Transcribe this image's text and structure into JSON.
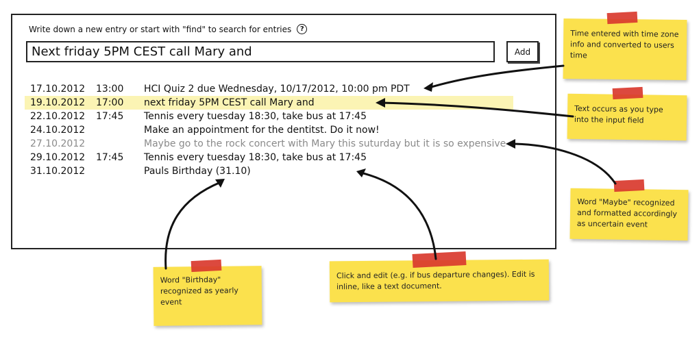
{
  "instruction": "Write down a new entry or start with \"find\" to search for entries",
  "help_icon_glyph": "?",
  "input": {
    "value": "Next friday 5PM CEST call Mary and"
  },
  "add_button_label": "Add",
  "entries": [
    {
      "date": "17.10.2012",
      "time": "13:00",
      "text": "HCI Quiz 2 due Wednesday, 10/17/2012, 10:00 pm PDT",
      "style": "normal"
    },
    {
      "date": "19.10.2012",
      "time": "17:00",
      "text": "next friday 5PM CEST call Mary and",
      "style": "highlight"
    },
    {
      "date": "22.10.2012",
      "time": "17:45",
      "text": "Tennis every tuesday 18:30, take bus at 17:45",
      "style": "normal"
    },
    {
      "date": "24.10.2012",
      "time": "",
      "text": "Make an appointment for the dentitst. Do it now!",
      "style": "normal"
    },
    {
      "date": "27.10.2012",
      "time": "",
      "text": "Maybe go to the rock concert with Mary this suturday but it is so expensive",
      "style": "uncertain"
    },
    {
      "date": "29.10.2012",
      "time": "17:45",
      "text": "Tennis every tuesday 18:30, take bus at 17:45",
      "style": "normal"
    },
    {
      "date": "31.10.2012",
      "time": "",
      "text": "Pauls Birthday (31.10)",
      "style": "normal"
    }
  ],
  "notes": {
    "time_zone": "Time entered with time zone info and converted to users time",
    "typing": "Text occurs as you type into the input field",
    "maybe": "Word \"Maybe\" recognized and formatted accordingly as uncertain event",
    "birthday": "Word \"Birthday\" recognized as yearly event",
    "click_edit": "Click and edit (e.g. if bus departure changes). Edit is inline, like a text document."
  },
  "colors": {
    "note": "#fbe14d",
    "tape": "#d93a2e",
    "highlight": "#fbf4b4",
    "uncertain_text": "#8a8a8a"
  }
}
